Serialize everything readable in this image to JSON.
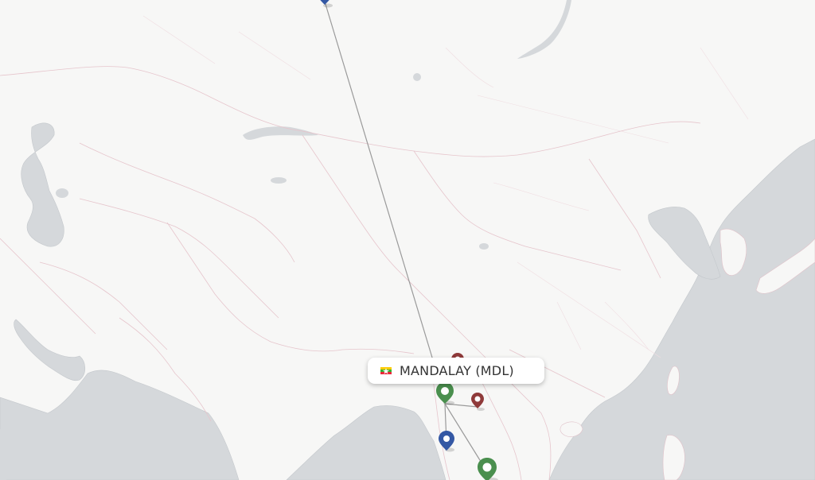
{
  "map": {
    "selected_airport": {
      "label": "MANDALAY (MDL)",
      "country_flag": "myanmar-flag"
    },
    "colors": {
      "land": "#f7f7f6",
      "water": "#d5d8db",
      "border": "#e8c8cf",
      "route_line": "#999999",
      "pin_green": "#4a8f4e",
      "pin_blue": "#3458a4",
      "pin_red": "#8f3a3a"
    },
    "destination_pins": [
      {
        "name": "pin-far-north",
        "color": "blue"
      },
      {
        "name": "pin-north-myanmar",
        "color": "red"
      },
      {
        "name": "pin-mandalay",
        "color": "green"
      },
      {
        "name": "pin-east",
        "color": "red"
      },
      {
        "name": "pin-yangon",
        "color": "blue"
      },
      {
        "name": "pin-bangkok",
        "color": "green"
      }
    ]
  }
}
